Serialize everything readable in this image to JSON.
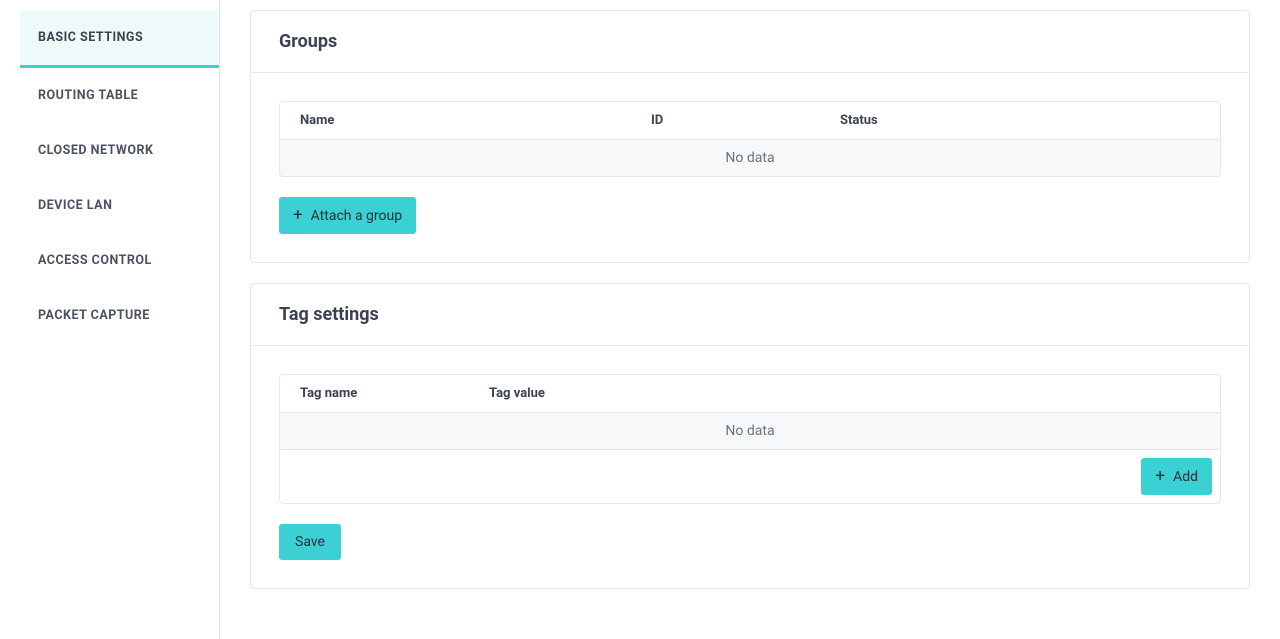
{
  "sidebar": {
    "items": [
      {
        "label": "BASIC SETTINGS",
        "active": true
      },
      {
        "label": "ROUTING TABLE",
        "active": false
      },
      {
        "label": "CLOSED NETWORK",
        "active": false
      },
      {
        "label": "DEVICE LAN",
        "active": false
      },
      {
        "label": "ACCESS CONTROL",
        "active": false
      },
      {
        "label": "PACKET CAPTURE",
        "active": false
      }
    ]
  },
  "groups_card": {
    "title": "Groups",
    "columns": {
      "name": "Name",
      "id": "ID",
      "status": "Status"
    },
    "no_data": "No data",
    "attach_label": "Attach a group"
  },
  "tags_card": {
    "title": "Tag settings",
    "columns": {
      "tag_name": "Tag name",
      "tag_value": "Tag value"
    },
    "no_data": "No data",
    "add_label": "Add",
    "save_label": "Save"
  }
}
